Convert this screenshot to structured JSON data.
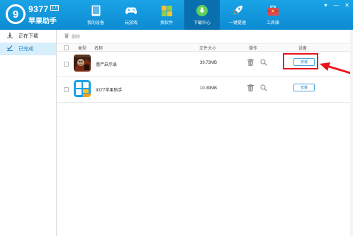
{
  "brand": {
    "number": "9377",
    "version": "1.0",
    "name": "苹果助手",
    "logo_glyph": "9"
  },
  "nav": [
    {
      "label": "我的设备",
      "icon": "tablet-icon"
    },
    {
      "label": "玩游戏",
      "icon": "gamepad-icon"
    },
    {
      "label": "找软件",
      "icon": "apps-grid-icon"
    },
    {
      "label": "下载中心",
      "icon": "download-icon",
      "active": true
    },
    {
      "label": "一键提速",
      "icon": "rocket-icon"
    },
    {
      "label": "工具箱",
      "icon": "toolbox-icon"
    }
  ],
  "window_controls": [
    "▾",
    "—",
    "✕"
  ],
  "sidebar": [
    {
      "label": "正在下载",
      "icon": "download-icon"
    },
    {
      "label": "已完成",
      "icon": "check-icon",
      "active": true
    }
  ],
  "toolbar": {
    "delete_label": "删除"
  },
  "table": {
    "headers": {
      "type": "类型",
      "name": "名称",
      "size": "文件大小",
      "operation": "操作",
      "device": "设备"
    },
    "rows": [
      {
        "name": "僵尸启示录",
        "size": "39.73MB",
        "action": "安装"
      },
      {
        "name": "9377苹果助手",
        "size": "10.39MB",
        "action": "安装"
      }
    ]
  },
  "colors": {
    "header_blue": "#1aa3e6",
    "active_nav": "#0a6fae",
    "highlight_red": "#e8141d",
    "link_blue": "#1a84c7"
  }
}
